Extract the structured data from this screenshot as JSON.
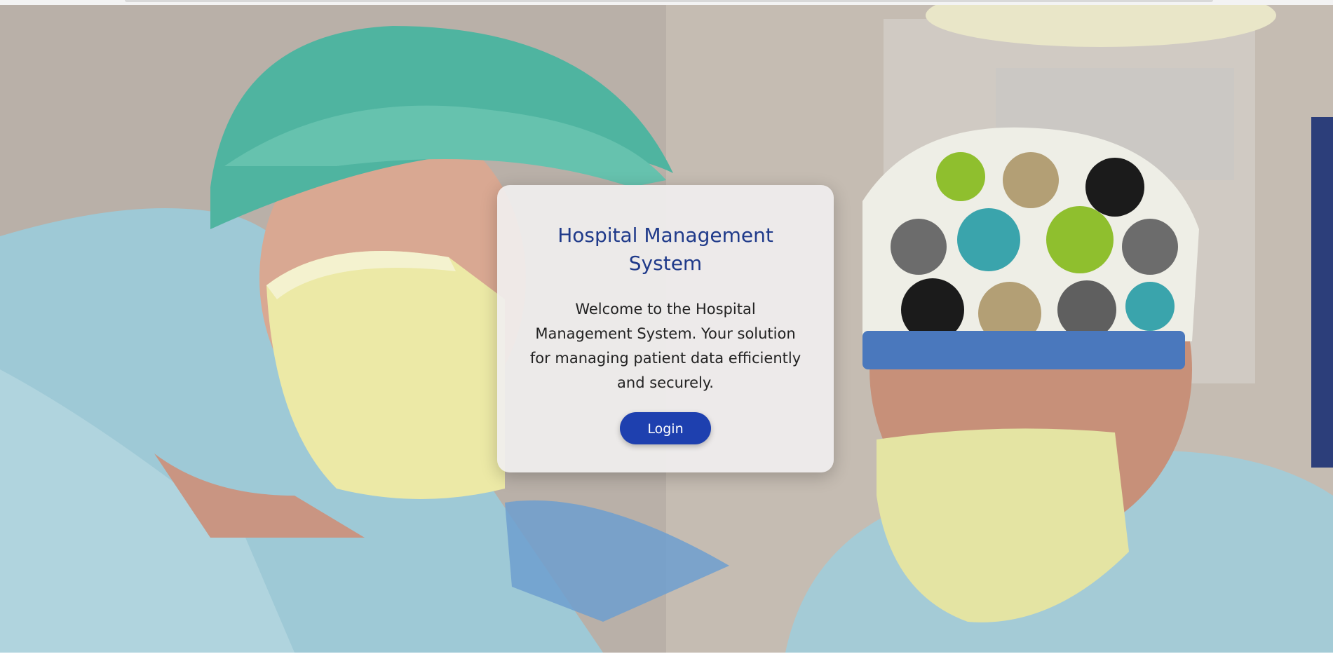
{
  "card": {
    "title": "Hospital Management System",
    "description": "Welcome to the Hospital Management System. Your solution for managing patient data efficiently and securely.",
    "login_label": "Login"
  },
  "colors": {
    "title": "#1f3a8a",
    "button": "#1e40af",
    "card_background": "#f0eeee"
  },
  "background": {
    "image_subject": "surgeons-in-operating-room-photo"
  }
}
